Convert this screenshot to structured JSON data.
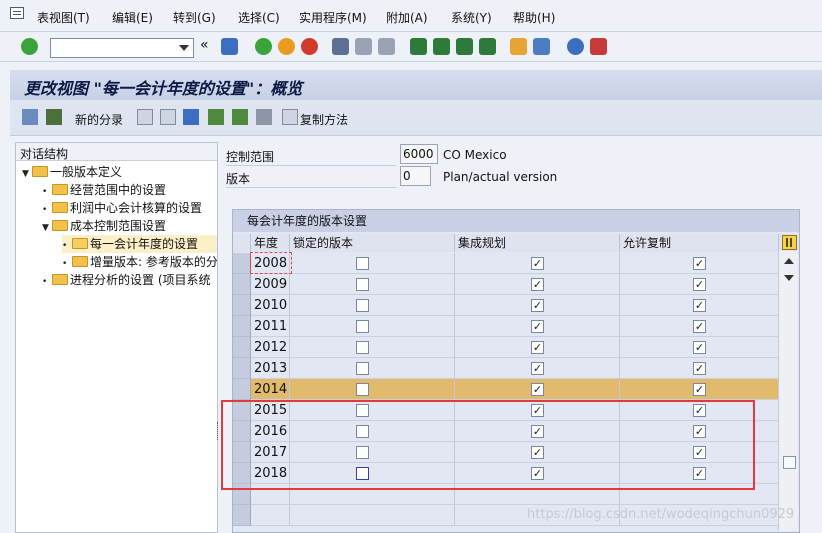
{
  "menubar": {
    "items": [
      "表视图(T)",
      "编辑(E)",
      "转到(G)",
      "选择(C)",
      "实用程序(M)",
      "附加(A)",
      "系统(Y)",
      "帮助(H)"
    ]
  },
  "toolbar": {
    "command_field_value": "",
    "icons": [
      "enter-icon",
      "save-icon",
      "back-icon",
      "exit-icon",
      "cancel-icon",
      "print-icon",
      "find-icon",
      "find-next-icon",
      "first-page-icon",
      "previous-page-icon",
      "next-page-icon",
      "last-page-icon",
      "new-session-icon",
      "shortcut-icon",
      "help-icon",
      "layout-icon"
    ],
    "colors": {
      "enter": "#3aa33a",
      "save": "#3a6fc0",
      "back": "#3aa33a",
      "exit": "#e89b1e",
      "cancel": "#d23b2a"
    }
  },
  "title": "更改视图 \"每一会计年度的设置\"：概览",
  "app_toolbar": {
    "new_entries_label": "新的分录",
    "copy_method_label": "复制方法"
  },
  "tree": {
    "header": "对话结构",
    "items": [
      {
        "label": "一般版本定义",
        "expanded": true
      },
      {
        "label": "经营范围中的设置"
      },
      {
        "label": "利润中心会计核算的设置"
      },
      {
        "label": "成本控制范围设置",
        "expanded": true
      },
      {
        "label": "每一会计年度的设置",
        "selected": true
      },
      {
        "label": "增量版本: 参考版本的分"
      },
      {
        "label": "进程分析的设置 (项目系统"
      }
    ]
  },
  "header_fields": {
    "controlling_area_label": "控制范围",
    "controlling_area_value": "6000",
    "controlling_area_desc": "CO Mexico",
    "version_label": "版本",
    "version_value": "0",
    "version_desc": "Plan/actual version"
  },
  "table": {
    "title": "每会计年度的版本设置",
    "columns": [
      "年度",
      "锁定的版本",
      "集成规划",
      "允许复制"
    ],
    "rows": [
      {
        "year": "2008",
        "locked": false,
        "integrated": true,
        "copy": true
      },
      {
        "year": "2009",
        "locked": false,
        "integrated": true,
        "copy": true
      },
      {
        "year": "2010",
        "locked": false,
        "integrated": true,
        "copy": true
      },
      {
        "year": "2011",
        "locked": false,
        "integrated": true,
        "copy": true
      },
      {
        "year": "2012",
        "locked": false,
        "integrated": true,
        "copy": true
      },
      {
        "year": "2013",
        "locked": false,
        "integrated": true,
        "copy": true
      },
      {
        "year": "2014",
        "locked": false,
        "integrated": true,
        "copy": true,
        "highlighted": true
      },
      {
        "year": "2015",
        "locked": false,
        "integrated": true,
        "copy": true
      },
      {
        "year": "2016",
        "locked": false,
        "integrated": true,
        "copy": true
      },
      {
        "year": "2017",
        "locked": false,
        "integrated": true,
        "copy": true
      },
      {
        "year": "2018",
        "locked": false,
        "integrated": true,
        "copy": true
      }
    ],
    "check_glyph": "✓",
    "highlight_color": "#e2ba6b"
  },
  "watermark": "https://blog.csdn.net/wodeqingchun0929"
}
